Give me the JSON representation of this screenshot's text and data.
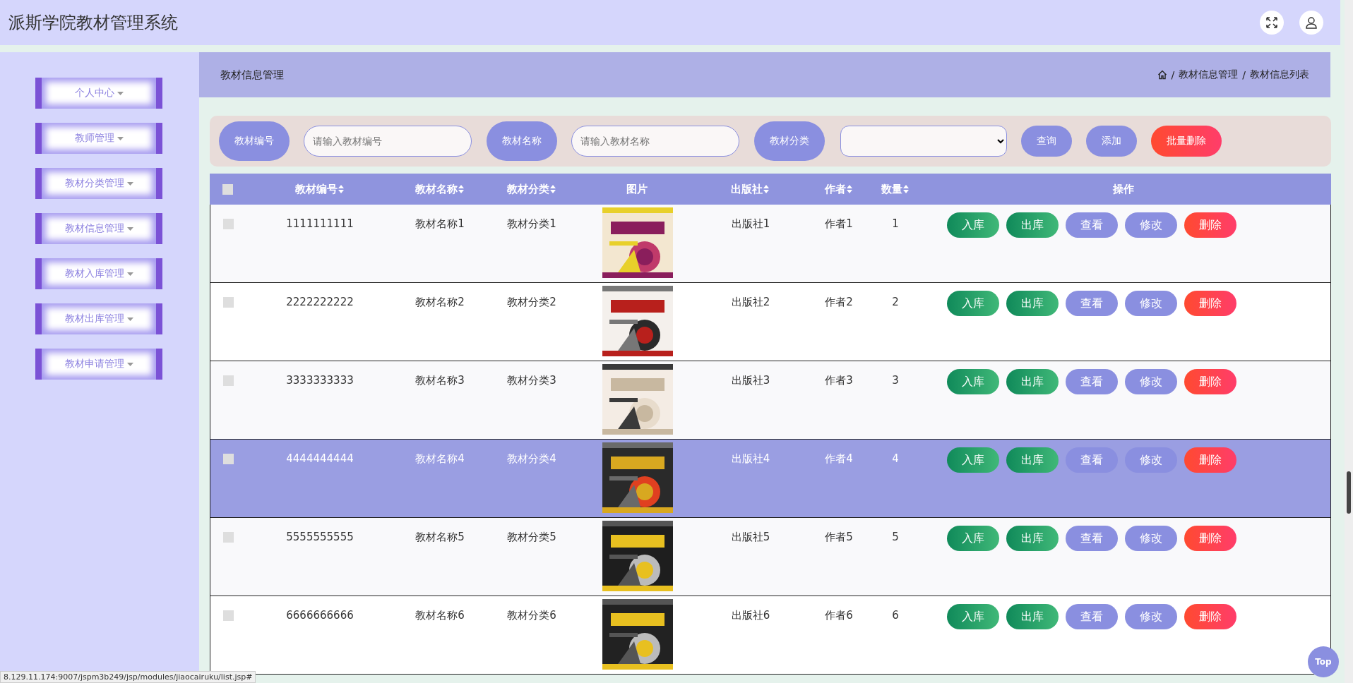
{
  "header": {
    "title": "派斯学院教材管理系统"
  },
  "sidebar": {
    "items": [
      {
        "label": "个人中心",
        "has_submenu": true
      },
      {
        "label": "教师管理",
        "has_submenu": true
      },
      {
        "label": "教材分类管理",
        "has_submenu": true
      },
      {
        "label": "教材信息管理",
        "has_submenu": true
      },
      {
        "label": "教材入库管理",
        "has_submenu": true
      },
      {
        "label": "教材出库管理",
        "has_submenu": true
      },
      {
        "label": "教材申请管理",
        "has_submenu": true
      }
    ]
  },
  "page_header": {
    "title": "教材信息管理",
    "breadcrumb": [
      {
        "separator": "/",
        "label": "教材信息管理"
      },
      {
        "separator": "/",
        "label": "教材信息列表"
      }
    ]
  },
  "search": {
    "fields": [
      {
        "label": "教材编号",
        "placeholder": "请输入教材编号",
        "kind": "input"
      },
      {
        "label": "教材名称",
        "placeholder": "请输入教材名称",
        "kind": "input"
      },
      {
        "label": "教材分类",
        "kind": "select"
      }
    ],
    "buttons": [
      {
        "label": "查询",
        "kind": "primary"
      },
      {
        "label": "添加",
        "kind": "primary"
      },
      {
        "label": "批量删除",
        "kind": "danger"
      }
    ]
  },
  "table": {
    "select_all": {
      "checked": false
    },
    "columns": [
      {
        "label": "教材编号",
        "sortable": true
      },
      {
        "label": "教材名称",
        "sortable": true
      },
      {
        "label": "教材分类",
        "sortable": true
      },
      {
        "label": "图片",
        "sortable": false
      },
      {
        "label": "出版社",
        "sortable": true
      },
      {
        "label": "作者",
        "sortable": true
      },
      {
        "label": "数量",
        "sortable": true
      },
      {
        "label": "操作",
        "sortable": false
      }
    ],
    "rows": [
      {
        "id": "1111111111",
        "name": "教材名称1",
        "category": "教材分类1",
        "picture": {
          "kind": "picture"
        },
        "publisher": "出版社1",
        "author": "作者1",
        "quantity": "1",
        "checked": false,
        "highlighted": false,
        "actions": [
          {
            "label": "入库",
            "kind": "success"
          },
          {
            "label": "出库",
            "kind": "success"
          },
          {
            "label": "查看",
            "kind": "primary"
          },
          {
            "label": "修改",
            "kind": "primary"
          },
          {
            "label": "删除",
            "kind": "danger"
          }
        ]
      },
      {
        "id": "2222222222",
        "name": "教材名称2",
        "category": "教材分类2",
        "picture": {
          "kind": "picture"
        },
        "publisher": "出版社2",
        "author": "作者2",
        "quantity": "2",
        "checked": false,
        "highlighted": false,
        "actions": [
          {
            "label": "入库",
            "kind": "success"
          },
          {
            "label": "出库",
            "kind": "success"
          },
          {
            "label": "查看",
            "kind": "primary"
          },
          {
            "label": "修改",
            "kind": "primary"
          },
          {
            "label": "删除",
            "kind": "danger"
          }
        ]
      },
      {
        "id": "3333333333",
        "name": "教材名称3",
        "category": "教材分类3",
        "picture": {
          "kind": "picture"
        },
        "publisher": "出版社3",
        "author": "作者3",
        "quantity": "3",
        "checked": false,
        "highlighted": false,
        "actions": [
          {
            "label": "入库",
            "kind": "success"
          },
          {
            "label": "出库",
            "kind": "success"
          },
          {
            "label": "查看",
            "kind": "primary"
          },
          {
            "label": "修改",
            "kind": "primary"
          },
          {
            "label": "删除",
            "kind": "danger"
          }
        ]
      },
      {
        "id": "4444444444",
        "name": "教材名称4",
        "category": "教材分类4",
        "picture": {
          "kind": "picture"
        },
        "publisher": "出版社4",
        "author": "作者4",
        "quantity": "4",
        "checked": false,
        "highlighted": true,
        "actions": [
          {
            "label": "入库",
            "kind": "success"
          },
          {
            "label": "出库",
            "kind": "success"
          },
          {
            "label": "查看",
            "kind": "primary"
          },
          {
            "label": "修改",
            "kind": "primary"
          },
          {
            "label": "删除",
            "kind": "danger"
          }
        ]
      },
      {
        "id": "5555555555",
        "name": "教材名称5",
        "category": "教材分类5",
        "picture": {
          "kind": "picture"
        },
        "publisher": "出版社5",
        "author": "作者5",
        "quantity": "5",
        "checked": false,
        "highlighted": false,
        "actions": [
          {
            "label": "入库",
            "kind": "success"
          },
          {
            "label": "出库",
            "kind": "success"
          },
          {
            "label": "查看",
            "kind": "primary"
          },
          {
            "label": "修改",
            "kind": "primary"
          },
          {
            "label": "删除",
            "kind": "danger"
          }
        ]
      },
      {
        "id": "6666666666",
        "name": "教材名称6",
        "category": "教材分类6",
        "picture": {
          "kind": "picture"
        },
        "publisher": "出版社6",
        "author": "作者6",
        "quantity": "6",
        "checked": false,
        "highlighted": false,
        "actions": [
          {
            "label": "入库",
            "kind": "success"
          },
          {
            "label": "出库",
            "kind": "success"
          },
          {
            "label": "查看",
            "kind": "primary"
          },
          {
            "label": "修改",
            "kind": "primary"
          },
          {
            "label": "删除",
            "kind": "danger"
          }
        ]
      }
    ]
  },
  "back_to_top": {
    "label": "Top"
  },
  "status_bar": {
    "url": "8.129.11.174:9007/jspm3b249/jsp/modules/jiaocairuku/list.jsp#"
  }
}
